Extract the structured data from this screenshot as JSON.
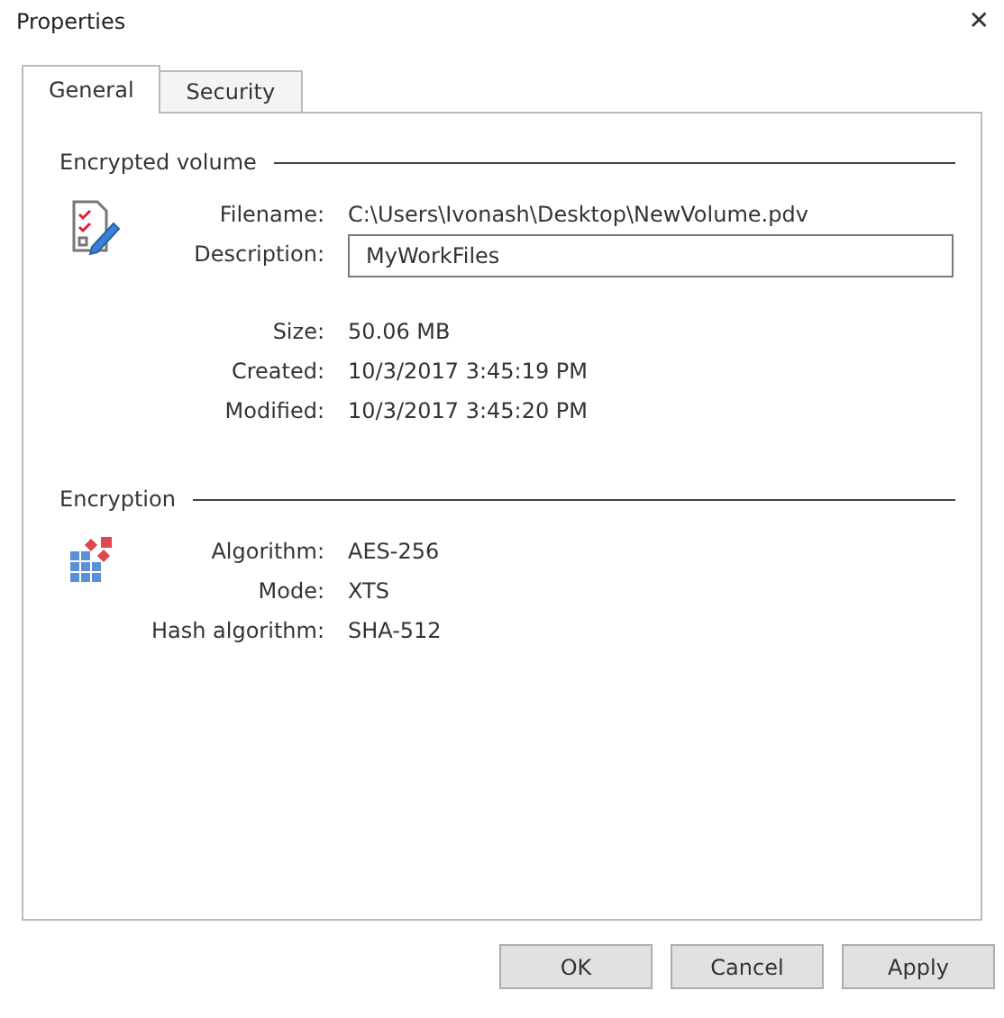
{
  "window": {
    "title": "Properties",
    "close": "✕"
  },
  "tabs": [
    {
      "label": "General",
      "selected": true
    },
    {
      "label": "Security",
      "selected": false
    }
  ],
  "sections": [
    {
      "title": "Encrypted volume",
      "groups": [
        [
          {
            "label": "Filename:",
            "kind": "text",
            "value": "C:\\Users\\Ivonash\\Desktop\\NewVolume.pdv"
          },
          {
            "label": "Description:",
            "kind": "field",
            "value": "MyWorkFiles"
          }
        ],
        [
          {
            "label": "Size:",
            "kind": "text",
            "value": "50.06 MB"
          },
          {
            "label": "Created:",
            "kind": "text",
            "value": "10/3/2017 3:45:19 PM"
          },
          {
            "label": "Modified:",
            "kind": "text",
            "value": "10/3/2017 3:45:20 PM"
          }
        ]
      ]
    },
    {
      "title": "Encryption",
      "groups": [
        [
          {
            "label": "Algorithm:",
            "kind": "text",
            "value": "AES-256"
          },
          {
            "label": "Mode:",
            "kind": "text",
            "value": "XTS"
          },
          {
            "label": "Hash algorithm:",
            "kind": "text",
            "value": "SHA-512"
          }
        ]
      ]
    }
  ],
  "buttons": [
    "OK",
    "Cancel",
    "Apply"
  ]
}
